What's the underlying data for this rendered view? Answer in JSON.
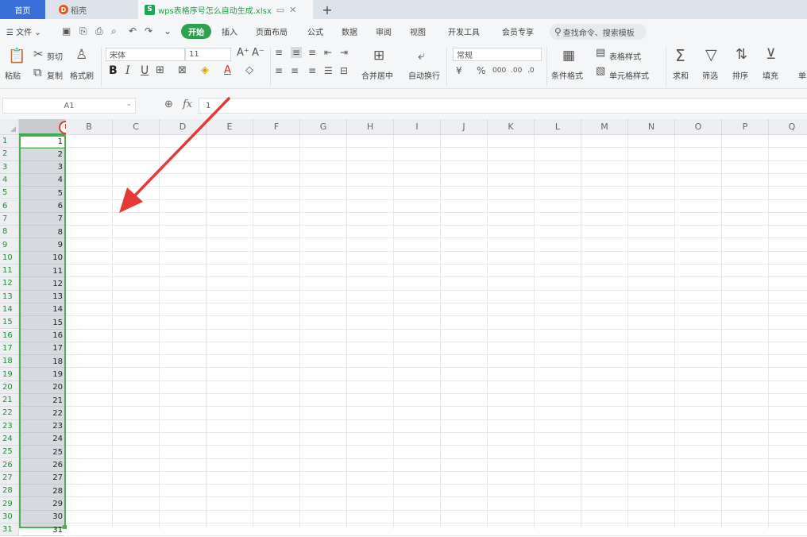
{
  "tabs": {
    "home": "首页",
    "daoke": "稻壳",
    "file": "wps表格序号怎么自动生成.xlsx",
    "add": "+"
  },
  "menubar": {
    "file_menu": "文件",
    "start": "开始",
    "items": [
      "插入",
      "页面布局",
      "公式",
      "数据",
      "审阅",
      "视图",
      "开发工具",
      "会员专享"
    ],
    "search": "查找命令、搜索模板"
  },
  "ribbon": {
    "paste": "粘贴",
    "cut": "剪切",
    "copy": "复制",
    "format_painter": "格式刷",
    "font_name": "宋体",
    "font_size": "11",
    "number_format": "常规",
    "merge_center": "合并居中",
    "wrap_text": "自动换行",
    "cond_format": "条件格式",
    "table_style": "表格样式",
    "cell_style": "单元格样式",
    "sum": "求和",
    "filter": "筛选",
    "sort": "排序",
    "fill": "填充",
    "cell_short": "单"
  },
  "formula": {
    "name_box": "A1",
    "fx": "fx",
    "content": "1"
  },
  "columns": [
    "B",
    "C",
    "D",
    "E",
    "F",
    "G",
    "H",
    "I",
    "J",
    "K",
    "L",
    "M",
    "N",
    "O",
    "P",
    "Q"
  ],
  "rows": [
    "1",
    "2",
    "3",
    "4",
    "5",
    "6",
    "7",
    "8",
    "9",
    "10",
    "11",
    "12",
    "13",
    "14",
    "15",
    "16",
    "17",
    "18",
    "19",
    "20",
    "21",
    "22",
    "23",
    "24",
    "25",
    "26",
    "27",
    "28",
    "29",
    "30",
    "31"
  ],
  "column_a": [
    "1",
    "2",
    "3",
    "4",
    "5",
    "6",
    "7",
    "8",
    "9",
    "10",
    "11",
    "12",
    "13",
    "14",
    "15",
    "16",
    "17",
    "18",
    "19",
    "20",
    "21",
    "22",
    "23",
    "24",
    "25",
    "26",
    "27",
    "28",
    "29",
    "30",
    "31"
  ],
  "colors": {
    "accent_green": "#2ea14f",
    "selection_border": "#4caf50",
    "arrow_red": "#e53935",
    "home_tab": "#3a6fd8"
  }
}
